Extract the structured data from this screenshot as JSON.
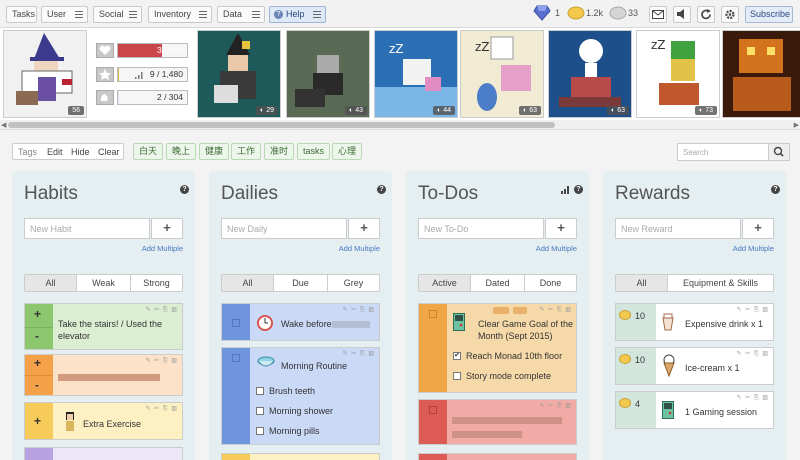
{
  "topbar": {
    "menus": [
      "Tasks",
      "User",
      "Social",
      "Inventory",
      "Data",
      "Help"
    ],
    "gems": "1",
    "gold": "1.2k",
    "silver": "33",
    "subscribe": "Subscribe"
  },
  "stats": {
    "hp": "32 / 50",
    "hp_fraction": 0.64,
    "xp": "9 / 1,480",
    "xp_fraction": 0.006,
    "mp": "2 / 304",
    "mp_fraction": 0.007,
    "level_main": "56"
  },
  "party_levels": [
    "29",
    "43",
    "44",
    "63",
    "63",
    "73",
    ""
  ],
  "tags": {
    "label": "Tags",
    "edit": "Edit",
    "hide": "Hide",
    "clear": "Clear",
    "items": [
      "白天",
      "晚上",
      "健康",
      "工作",
      "准时",
      "tasks",
      "心理"
    ]
  },
  "search_placeholder": "Search",
  "habits": {
    "title": "Habits",
    "placeholder": "New Habit",
    "add_multiple": "Add Multiple",
    "filters": [
      "All",
      "Weak",
      "Strong"
    ],
    "tasks": [
      {
        "text": "Take the stairs! / Used the elevator"
      },
      {
        "text": ""
      },
      {
        "text": "Extra Exercise"
      }
    ]
  },
  "dailies": {
    "title": "Dailies",
    "placeholder": "New Daily",
    "add_multiple": "Add Multiple",
    "filters": [
      "All",
      "Due",
      "Grey"
    ],
    "tasks": [
      {
        "text": "Wake before"
      },
      {
        "text": "Morning Routine",
        "checklist": [
          "Brush teeth",
          "Morning shower",
          "Morning pills"
        ]
      }
    ]
  },
  "todos": {
    "title": "To-Dos",
    "placeholder": "New To-Do",
    "add_multiple": "Add Multiple",
    "filters": [
      "Active",
      "Dated",
      "Done"
    ],
    "tasks": [
      {
        "text": "Clear Game Goal of the Month (Sept 2015)",
        "checklist": [
          "Reach Monad 10th floor",
          "Story mode complete"
        ],
        "checked": [
          true,
          false
        ]
      }
    ]
  },
  "rewards": {
    "title": "Rewards",
    "placeholder": "New Reward",
    "add_multiple": "Add Multiple",
    "filters": [
      "All",
      "Equipment & Skills"
    ],
    "items": [
      {
        "price": "10",
        "text": "Expensive drink x 1"
      },
      {
        "price": "10",
        "text": "Ice-cream x 1"
      },
      {
        "price": "4",
        "text": "1 Gaming session"
      }
    ]
  },
  "colors": {
    "hp_bar": "#c9474a",
    "xp_bar": "#e3b64a",
    "mp_bar": "#dfe6f3",
    "habit_green": "#b8dfa6",
    "habit_orange": "#f7c889",
    "daily_blue": "#b9cdf1",
    "todo_orange": "#f6d9a8",
    "todo_red": "#f2aaa6"
  }
}
